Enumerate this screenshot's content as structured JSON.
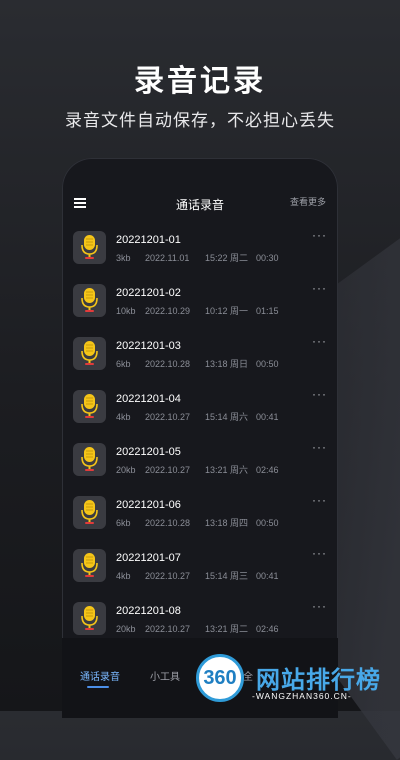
{
  "promo": {
    "title": "录音记录",
    "subtitle": "录音文件自动保存，不必担心丢失"
  },
  "header": {
    "menu_icon": "hamburger-menu-icon",
    "title": "通话录音",
    "see_more": "查看更多"
  },
  "colors": {
    "accent": "#4c8fe8",
    "mic_yellow": "#f5c518",
    "mic_red": "#e23b3b"
  },
  "recordings": [
    {
      "name": "20221201-01",
      "size": "3kb",
      "date": "2022.11.01",
      "time": "15:22 周二",
      "duration": "00:30"
    },
    {
      "name": "20221201-02",
      "size": "10kb",
      "date": "2022.10.29",
      "time": "10:12 周一",
      "duration": "01:15"
    },
    {
      "name": "20221201-03",
      "size": "6kb",
      "date": "2022.10.28",
      "time": "13:18 周日",
      "duration": "00:50"
    },
    {
      "name": "20221201-04",
      "size": "4kb",
      "date": "2022.10.27",
      "time": "15:14 周六",
      "duration": "00:41"
    },
    {
      "name": "20221201-05",
      "size": "20kb",
      "date": "2022.10.27",
      "time": "13:21 周六",
      "duration": "02:46"
    },
    {
      "name": "20221201-06",
      "size": "6kb",
      "date": "2022.10.28",
      "time": "13:18 周四",
      "duration": "00:50"
    },
    {
      "name": "20221201-07",
      "size": "4kb",
      "date": "2022.10.27",
      "time": "15:14 周三",
      "duration": "00:41"
    },
    {
      "name": "20221201-08",
      "size": "20kb",
      "date": "2022.10.27",
      "time": "13:21 周二",
      "duration": "02:46"
    }
  ],
  "more_label": "···",
  "nav": {
    "tab_recording": "通话录音",
    "tab_tools": "小工具",
    "tab_partial": "全"
  },
  "watermark": {
    "logo_text": "360",
    "site_name": "网站排行榜",
    "url": "-WANGZHAN360.CN-"
  }
}
